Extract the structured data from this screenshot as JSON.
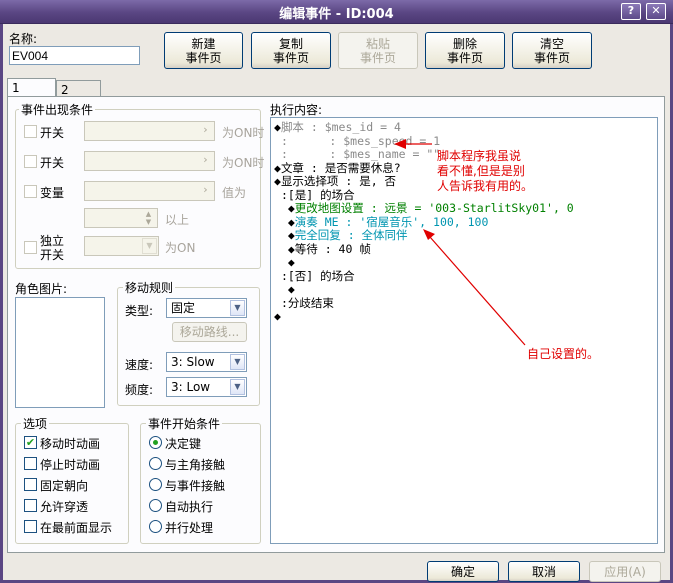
{
  "window": {
    "title": "编辑事件 - ID:004",
    "help_icon": "question-icon",
    "close_icon": "close-icon"
  },
  "name": {
    "label": "名称:",
    "value": "EV004"
  },
  "toolbar": {
    "new_line1": "新建",
    "new_line2": "事件页",
    "copy_line1": "复制",
    "copy_line2": "事件页",
    "paste_line1": "粘贴",
    "paste_line2": "事件页",
    "delete_line1": "删除",
    "delete_line2": "事件页",
    "clear_line1": "清空",
    "clear_line2": "事件页"
  },
  "tabs": [
    "1",
    "2"
  ],
  "conditions": {
    "title": "事件出现条件",
    "switch1": {
      "label": "开关",
      "suffix": "为ON时"
    },
    "switch2": {
      "label": "开关",
      "suffix": "为ON时"
    },
    "variable": {
      "label": "变量",
      "suffix": "值为",
      "value_suffix": "以上"
    },
    "self_switch": {
      "label1": "独立",
      "label2": "开关",
      "suffix": "为ON"
    }
  },
  "graphic": {
    "title": "角色图片:"
  },
  "movement": {
    "title": "移动规则",
    "type_label": "类型:",
    "type_value": "固定",
    "route_button": "移动路线...",
    "speed_label": "速度:",
    "speed_value": "3: Slow",
    "freq_label": "频度:",
    "freq_value": "3: Low"
  },
  "options": {
    "title": "选项",
    "items": [
      {
        "label": "移动时动画",
        "checked": true
      },
      {
        "label": "停止时动画",
        "checked": false
      },
      {
        "label": "固定朝向",
        "checked": false
      },
      {
        "label": "允许穿透",
        "checked": false
      },
      {
        "label": "在最前面显示",
        "checked": false
      }
    ]
  },
  "trigger": {
    "title": "事件开始条件",
    "items": [
      {
        "label": "决定键",
        "selected": true
      },
      {
        "label": "与主角接触",
        "selected": false
      },
      {
        "label": "与事件接触",
        "selected": false
      },
      {
        "label": "自动执行",
        "selected": false
      },
      {
        "label": "并行处理",
        "selected": false
      }
    ]
  },
  "contents": {
    "title": "执行内容:",
    "lines": [
      {
        "bullet": "◆",
        "text": "脚本 : $mes_id = 4",
        "color": "gray"
      },
      {
        "bullet": " ",
        "text": ":      : $mes_speed = 1",
        "color": "gray"
      },
      {
        "bullet": " ",
        "text": ":      : $mes_name = \"\"",
        "color": "gray"
      },
      {
        "bullet": "◆",
        "text": "文章 : 是否需要休息?",
        "color": "black"
      },
      {
        "bullet": "◆",
        "text": "显示选择项 : 是, 否",
        "color": "black"
      },
      {
        "bullet": " ",
        "text": ":[是] 的场合",
        "color": "black"
      },
      {
        "bullet": "  ◆",
        "text": "更改地图设置 : 远景 = '003-StarlitSky01', 0",
        "color": "green"
      },
      {
        "bullet": "  ◆",
        "text": "演奏 ME : '宿屋音乐', 100, 100",
        "color": "teal"
      },
      {
        "bullet": "  ◆",
        "text": "完全回复 : 全体同伴",
        "color": "teal"
      },
      {
        "bullet": "  ◆",
        "text": "等待 : 40 帧",
        "color": "black"
      },
      {
        "bullet": "  ◆",
        "text": "",
        "color": "black"
      },
      {
        "bullet": " ",
        "text": ":[否] 的场合",
        "color": "black"
      },
      {
        "bullet": "  ◆",
        "text": "",
        "color": "black"
      },
      {
        "bullet": " ",
        "text": ":分歧结束",
        "color": "black"
      },
      {
        "bullet": "◆",
        "text": "",
        "color": "black"
      }
    ]
  },
  "annotations": {
    "note1_line1": "脚本程序我虽说",
    "note1_line2": "看不懂,但是是别",
    "note1_line3": "人告诉我有用的。",
    "note2": "自己设置的。",
    "color": "#e00000"
  },
  "footer": {
    "ok": "确定",
    "cancel": "取消",
    "apply": "应用(A)"
  }
}
